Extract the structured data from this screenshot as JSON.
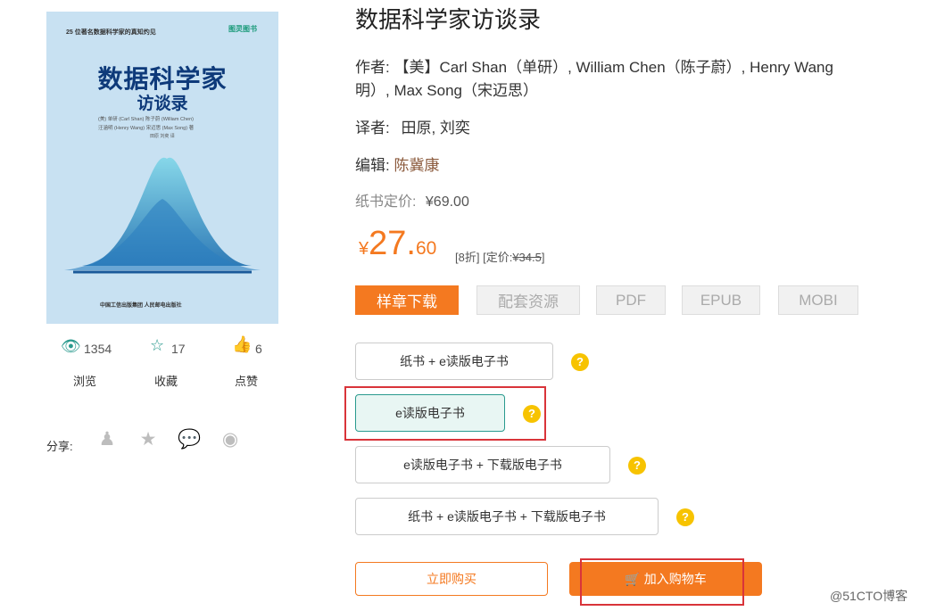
{
  "cover": {
    "tagline": "25 位著名数据科学家的真知灼见",
    "publisher_logo": "图灵图书",
    "title_line1": "数据科学家",
    "title_line2": "访谈录",
    "authors_line1": "(美) 单研 (Carl Shan)  陈子蔚 (William Chen)",
    "authors_line2": "汪涵明 (Henry Wang)  宋迈思 (Max Song)  著",
    "translators": "田原  刘奕  译",
    "publishers": "中国工信出版集团  人民邮电出版社"
  },
  "stats": [
    {
      "icon": "eye-icon",
      "glyph": "👁",
      "count": "1354",
      "label": "浏览"
    },
    {
      "icon": "star-icon",
      "glyph": "☆",
      "count": "17",
      "label": "收藏"
    },
    {
      "icon": "thumbs-up-icon",
      "glyph": "👍",
      "count": "6",
      "label": "点赞"
    }
  ],
  "share": {
    "label": "分享:",
    "icons": [
      {
        "name": "qq-icon",
        "glyph": "♟"
      },
      {
        "name": "qzone-icon",
        "glyph": "★"
      },
      {
        "name": "wechat-icon",
        "glyph": "💬"
      },
      {
        "name": "weibo-icon",
        "glyph": "◉"
      }
    ]
  },
  "book": {
    "title": "数据科学家访谈录",
    "author_label": "作者:",
    "authors_line1": "【美】Carl Shan（单研）, William Chen（陈子蔚）, Henry Wang",
    "authors_line2": "明）, Max Song（宋迈思）",
    "translator_label": "译者:",
    "translators": "田原, 刘奕",
    "editor_label": "编辑:",
    "editor": "陈冀康",
    "list_price_label": "纸书定价:",
    "list_price": "¥69.00",
    "price_yen": "¥",
    "price_int": "27",
    "price_dot": ".",
    "price_dec": "60",
    "discount": "[8折]",
    "ebook_list_label": "[定价:",
    "ebook_list_price": "¥34.5",
    "ebook_list_close": "]"
  },
  "formats": [
    "样章下载",
    "配套资源",
    "PDF",
    "EPUB",
    "MOBI"
  ],
  "options": [
    "纸书 + e读版电子书",
    "e读版电子书",
    "e读版电子书 + 下载版电子书",
    "纸书 + e读版电子书 + 下载版电子书"
  ],
  "help_glyph": "?",
  "buy_now": "立即购买",
  "add_to_cart": "加入购物车",
  "cart_glyph": "🛒",
  "watermark": "@51CTO博客",
  "colors": {
    "accent": "#f47920",
    "teal": "#2a9a8e",
    "highlight": "#d9343a",
    "help": "#f7c300"
  }
}
